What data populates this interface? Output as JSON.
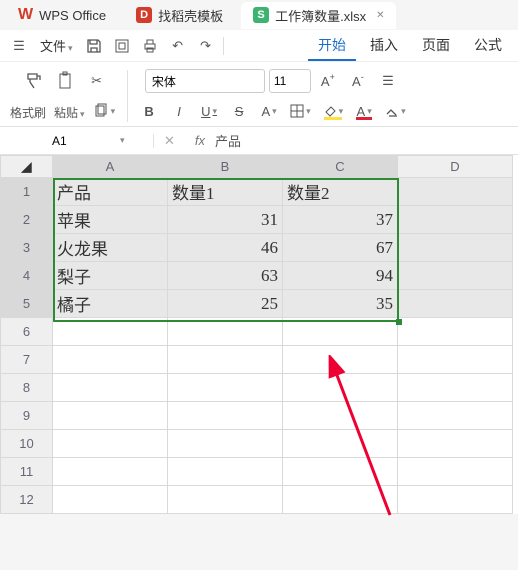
{
  "tabs": {
    "app": "WPS Office",
    "template": "找稻壳模板",
    "file": "工作簿数量.xlsx"
  },
  "menu": {
    "file": "文件",
    "start": "开始",
    "insert": "插入",
    "page": "页面",
    "formula": "公式"
  },
  "ribbon": {
    "format_brush": "格式刷",
    "paste": "粘贴",
    "font_name": "宋体",
    "font_size": "11"
  },
  "namebox": {
    "ref": "A1"
  },
  "formula": {
    "value": "产品"
  },
  "columns": [
    "A",
    "B",
    "C",
    "D"
  ],
  "rows": [
    "1",
    "2",
    "3",
    "4",
    "5",
    "6",
    "7",
    "8",
    "9",
    "10",
    "11",
    "12"
  ],
  "data": {
    "headers": [
      "产品",
      "数量1",
      "数量2"
    ],
    "r2": {
      "a": "苹果",
      "b": "31",
      "c": "37"
    },
    "r3": {
      "a": "火龙果",
      "b": "46",
      "c": "67"
    },
    "r4": {
      "a": "梨子",
      "b": "63",
      "c": "94"
    },
    "r5": {
      "a": "橘子",
      "b": "25",
      "c": "35"
    }
  },
  "chart_data": {
    "type": "table",
    "title": "",
    "columns": [
      "产品",
      "数量1",
      "数量2"
    ],
    "rows": [
      [
        "苹果",
        31,
        37
      ],
      [
        "火龙果",
        46,
        67
      ],
      [
        "梨子",
        63,
        94
      ],
      [
        "橘子",
        25,
        35
      ]
    ]
  }
}
